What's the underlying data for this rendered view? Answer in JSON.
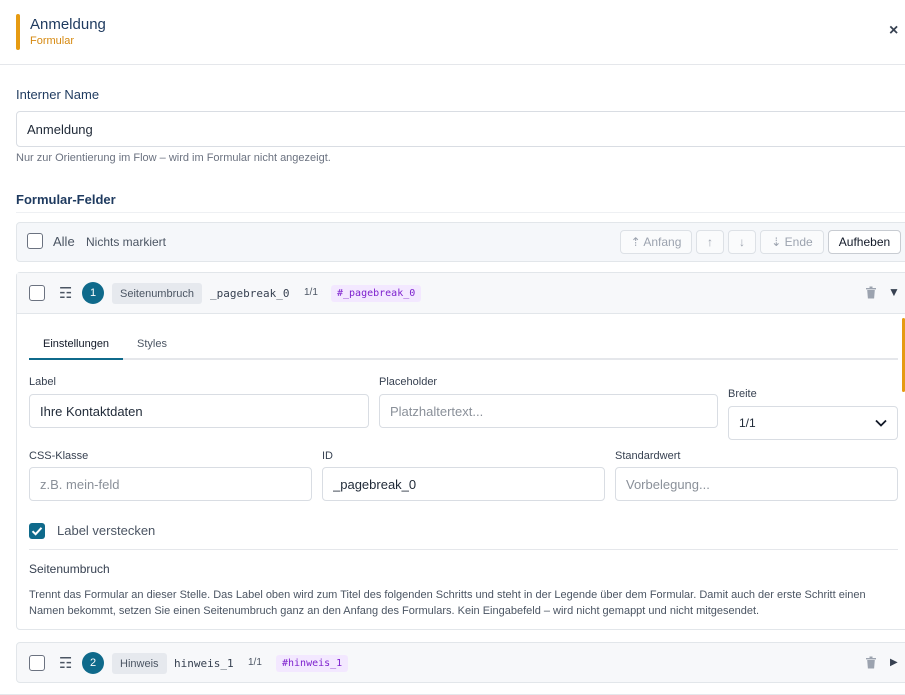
{
  "header": {
    "title": "Anmeldung",
    "subtitle": "Formular",
    "close_label": "×"
  },
  "internal_name": {
    "label": "Interner Name",
    "value": "Anmeldung",
    "help": "Nur zur Orientierung im Flow – wird im Formular nicht angezeigt."
  },
  "fields_section": {
    "title": "Formular-Felder"
  },
  "toolbar": {
    "select_all_label": "Alle",
    "status": "Nichts markiert",
    "btn_start": "⇡ Anfang",
    "btn_up": "↑",
    "btn_down": "↓",
    "btn_end": "⇣ Ende",
    "btn_clear": "Aufheben"
  },
  "fields": [
    {
      "number": "1",
      "type": "Seitenumbruch",
      "name": "_pagebreak_0",
      "width": "1/1",
      "id_tag": "#_pagebreak_0",
      "expanded": true,
      "chevron": "▼",
      "tabs": [
        "Einstellungen",
        "Styles"
      ],
      "settings": {
        "label_label": "Label",
        "label_value": "Ihre Kontaktdaten",
        "placeholder_label": "Placeholder",
        "placeholder_placeholder": "Platzhaltertext...",
        "width_label": "Breite",
        "width_value": "1/1",
        "css_label": "CSS-Klasse",
        "css_placeholder": "z.B. mein-feld",
        "id_label": "ID",
        "id_value": "_pagebreak_0",
        "default_label": "Standardwert",
        "default_placeholder": "Vorbelegung...",
        "hide_label": "Label verstecken",
        "hide_checked": true
      },
      "info_title": "Seitenumbruch",
      "info_text": "Trennt das Formular an dieser Stelle. Das Label oben wird zum Titel des folgenden Schritts und steht in der Legende über dem Formular. Damit auch der erste Schritt einen Namen bekommt, setzen Sie einen Seitenumbruch ganz an den Anfang des Formulars. Kein Eingabefeld – wird nicht gemappt und nicht mitgesendet."
    },
    {
      "number": "2",
      "type": "Hinweis",
      "name": "hinweis_1",
      "width": "1/1",
      "id_tag": "#hinweis_1",
      "expanded": false,
      "chevron": "▶"
    }
  ],
  "colors": {
    "accent": "#e69b12",
    "primary": "#0f6a8b",
    "id_tag_bg": "#f3e8ff",
    "id_tag_text": "#7e22ce"
  }
}
